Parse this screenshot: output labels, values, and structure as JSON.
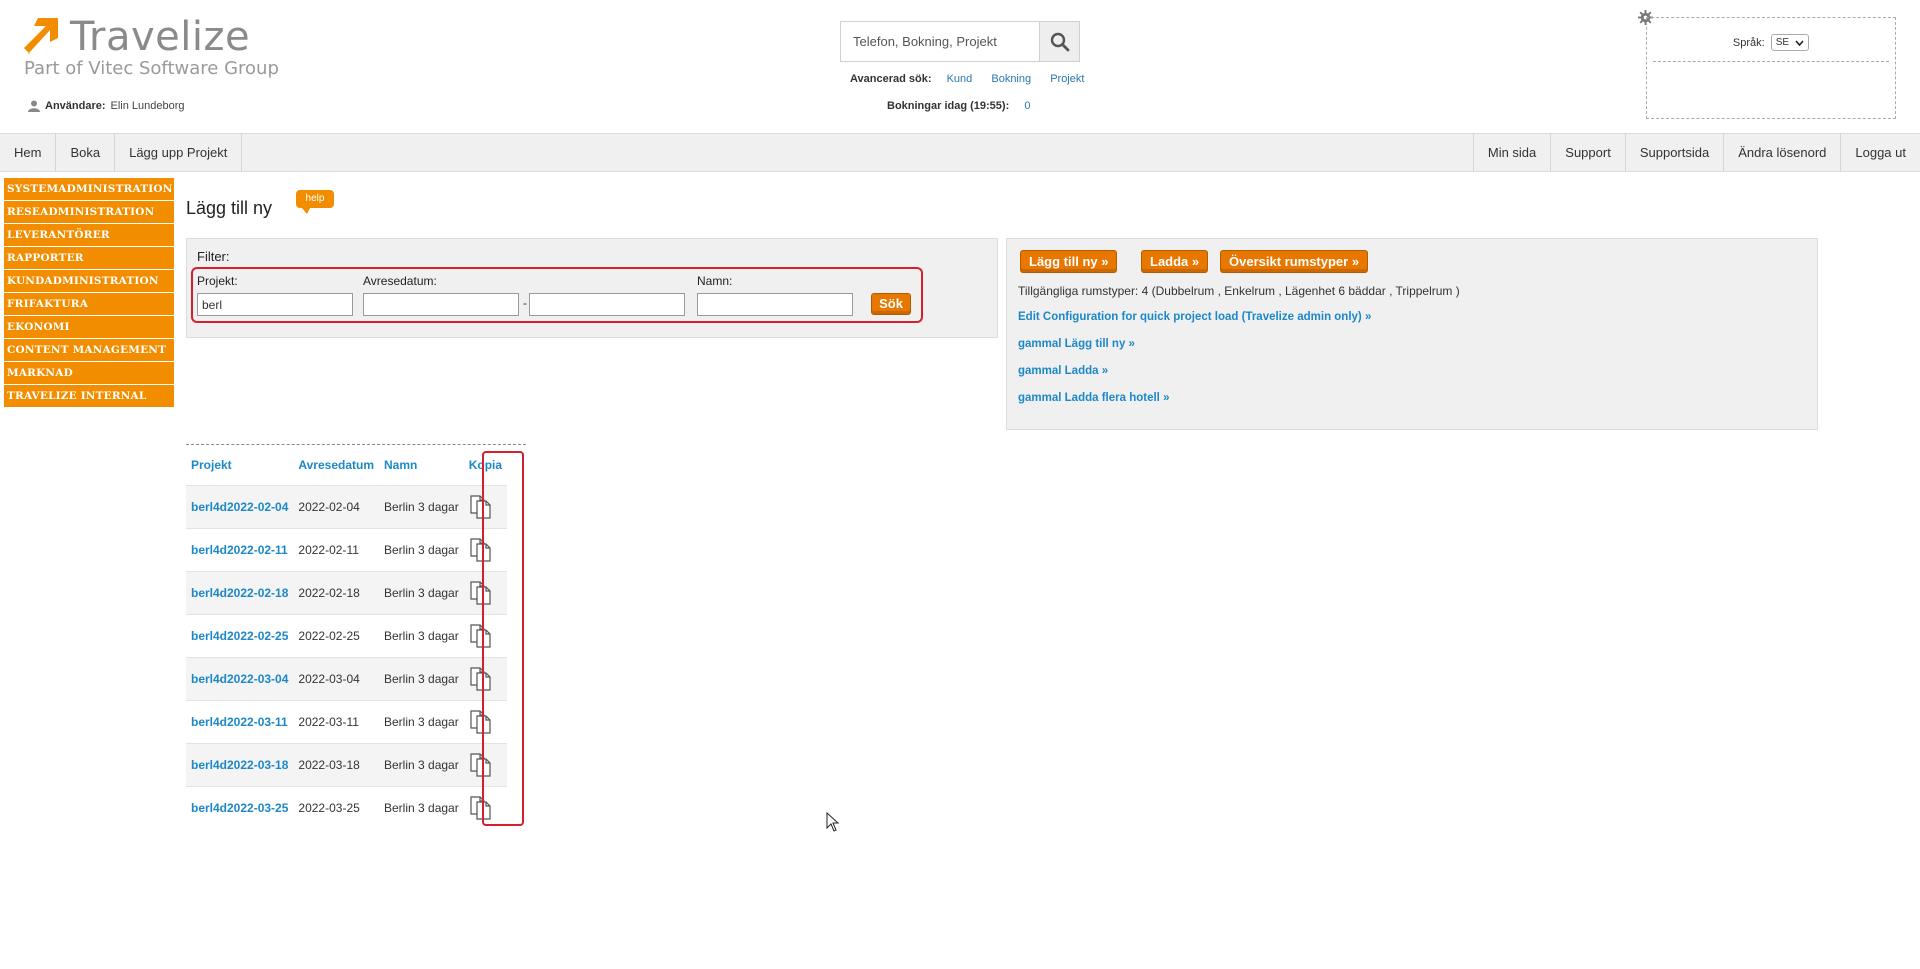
{
  "brand": {
    "name": "Travelize",
    "tagline": "Part of Vitec Software Group",
    "accent": "#f28d00"
  },
  "user": {
    "label": "Användare:",
    "name": "Elin Lundeborg"
  },
  "search": {
    "placeholder": "Telefon, Bokning, Projekt",
    "advanced_label": "Avancerad sök:",
    "advanced_links": [
      "Kund",
      "Bokning",
      "Projekt"
    ],
    "today_label": "Bokningar idag (19:55):",
    "today_count": "0"
  },
  "language": {
    "label": "Språk:",
    "selected": "SE"
  },
  "nav": {
    "left": [
      "Hem",
      "Boka",
      "Lägg upp Projekt"
    ],
    "right": [
      "Min sida",
      "Support",
      "Supportsida",
      "Ändra lösenord",
      "Logga ut"
    ]
  },
  "sidebar": [
    "SYSTEMADMINISTRATION",
    "RESEADMINISTRATION",
    "LEVERANTÖRER",
    "RAPPORTER",
    "KUNDADMINISTRATION",
    "FRIFAKTURA",
    "EKONOMI",
    "CONTENT MANAGEMENT",
    "MARKNAD",
    "TRAVELIZE INTERNAL"
  ],
  "page": {
    "title": "Lägg till ny",
    "help": "help"
  },
  "filter": {
    "title": "Filter:",
    "project_label": "Projekt:",
    "project_value": "berl",
    "date_label": "Avresedatum:",
    "date_separator": "-",
    "name_label": "Namn:",
    "search_button": "Sök"
  },
  "actions": {
    "buttons": [
      "Lägg till ny  »",
      "Ladda  »",
      "Översikt rumstyper »"
    ],
    "available_rooms": "Tillgängliga rumstyper: 4 (Dubbelrum , Enkelrum , Lägenhet 6 bäddar , Trippelrum )",
    "links": [
      "Edit Configuration for quick project load (Travelize admin only) »",
      "gammal Lägg till ny »",
      "gammal Ladda »",
      "gammal Ladda flera hotell »"
    ]
  },
  "results": {
    "columns": [
      "Projekt",
      "Avresedatum",
      "Namn",
      "Kopia"
    ],
    "rows": [
      {
        "project": "berl4d2022-02-04",
        "date": "2022-02-04",
        "name": "Berlin 3 dagar"
      },
      {
        "project": "berl4d2022-02-11",
        "date": "2022-02-11",
        "name": "Berlin 3 dagar"
      },
      {
        "project": "berl4d2022-02-18",
        "date": "2022-02-18",
        "name": "Berlin 3 dagar"
      },
      {
        "project": "berl4d2022-02-25",
        "date": "2022-02-25",
        "name": "Berlin 3 dagar"
      },
      {
        "project": "berl4d2022-03-04",
        "date": "2022-03-04",
        "name": "Berlin 3 dagar"
      },
      {
        "project": "berl4d2022-03-11",
        "date": "2022-03-11",
        "name": "Berlin 3 dagar"
      },
      {
        "project": "berl4d2022-03-18",
        "date": "2022-03-18",
        "name": "Berlin 3 dagar"
      },
      {
        "project": "berl4d2022-03-25",
        "date": "2022-03-25",
        "name": "Berlin 3 dagar"
      }
    ]
  }
}
